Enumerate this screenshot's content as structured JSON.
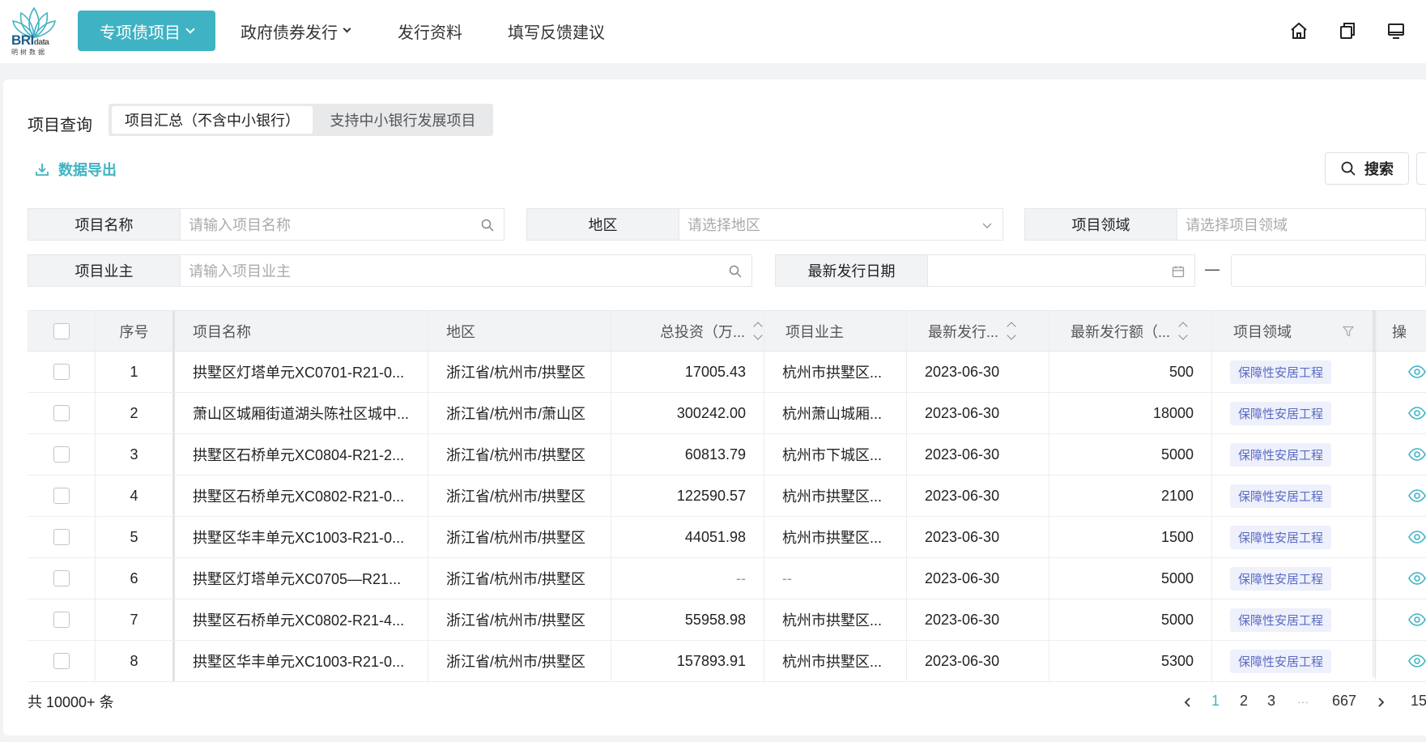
{
  "header": {
    "logo_text": "BRI",
    "logo_text_small": "data",
    "logo_sub": "明树数据",
    "nav": [
      {
        "label": "专项债项目",
        "has_caret": true,
        "active": true
      },
      {
        "label": "政府债券发行",
        "has_caret": true
      },
      {
        "label": "发行资料"
      },
      {
        "label": "填写反馈建议"
      }
    ],
    "icons": [
      "home-icon",
      "copy-icon",
      "monitor-icon"
    ]
  },
  "query": {
    "label": "项目查询",
    "segments": [
      "项目汇总（不含中小银行）",
      "支持中小银行发展项目"
    ],
    "export_label": "数据导出",
    "search_label": "搜索"
  },
  "filters": {
    "name": {
      "label": "项目名称",
      "placeholder": "请输入项目名称"
    },
    "region": {
      "label": "地区",
      "placeholder": "请选择地区"
    },
    "domain": {
      "label": "项目领域",
      "placeholder": "请选择项目领域"
    },
    "owner": {
      "label": "项目业主",
      "placeholder": "请输入项目业主"
    },
    "date": {
      "label": "最新发行日期",
      "separator": "—"
    }
  },
  "table": {
    "columns": [
      "序号",
      "项目名称",
      "地区",
      "总投资（万...",
      "项目业主",
      "最新发行...",
      "最新发行额（...",
      "项目领域",
      "操"
    ],
    "rows": [
      {
        "no": "1",
        "name": "拱墅区灯塔单元XC0701-R21-0...",
        "region": "浙江省/杭州市/拱墅区",
        "invest": "17005.43",
        "owner": "杭州市拱墅区...",
        "date": "2023-06-30",
        "amount": "500",
        "domain": "保障性安居工程"
      },
      {
        "no": "2",
        "name": "萧山区城厢街道湖头陈社区城中...",
        "region": "浙江省/杭州市/萧山区",
        "invest": "300242.00",
        "owner": "杭州萧山城厢...",
        "date": "2023-06-30",
        "amount": "18000",
        "domain": "保障性安居工程"
      },
      {
        "no": "3",
        "name": "拱墅区石桥单元XC0804-R21-2...",
        "region": "浙江省/杭州市/拱墅区",
        "invest": "60813.79",
        "owner": "杭州市下城区...",
        "date": "2023-06-30",
        "amount": "5000",
        "domain": "保障性安居工程"
      },
      {
        "no": "4",
        "name": "拱墅区石桥单元XC0802-R21-0...",
        "region": "浙江省/杭州市/拱墅区",
        "invest": "122590.57",
        "owner": "杭州市拱墅区...",
        "date": "2023-06-30",
        "amount": "2100",
        "domain": "保障性安居工程"
      },
      {
        "no": "5",
        "name": "拱墅区华丰单元XC1003-R21-0...",
        "region": "浙江省/杭州市/拱墅区",
        "invest": "44051.98",
        "owner": "杭州市拱墅区...",
        "date": "2023-06-30",
        "amount": "1500",
        "domain": "保障性安居工程"
      },
      {
        "no": "6",
        "name": "拱墅区灯塔单元XC0705—R21...",
        "region": "浙江省/杭州市/拱墅区",
        "invest": "--",
        "owner": "--",
        "date": "2023-06-30",
        "amount": "5000",
        "domain": "保障性安居工程"
      },
      {
        "no": "7",
        "name": "拱墅区石桥单元XC0802-R21-4...",
        "region": "浙江省/杭州市/拱墅区",
        "invest": "55958.98",
        "owner": "杭州市拱墅区...",
        "date": "2023-06-30",
        "amount": "5000",
        "domain": "保障性安居工程"
      },
      {
        "no": "8",
        "name": "拱墅区华丰单元XC1003-R21-0...",
        "region": "浙江省/杭州市/拱墅区",
        "invest": "157893.91",
        "owner": "杭州市拱墅区...",
        "date": "2023-06-30",
        "amount": "5300",
        "domain": "保障性安居工程"
      }
    ]
  },
  "footer": {
    "total": "共 10000+ 条",
    "pages": [
      "1",
      "2",
      "3",
      "···",
      "667"
    ],
    "current_page": "1",
    "page_size": "15"
  },
  "colors": {
    "accent": "#3fb3c3",
    "tag_text": "#5a6bc4",
    "tag_bg": "#eef0fb"
  }
}
